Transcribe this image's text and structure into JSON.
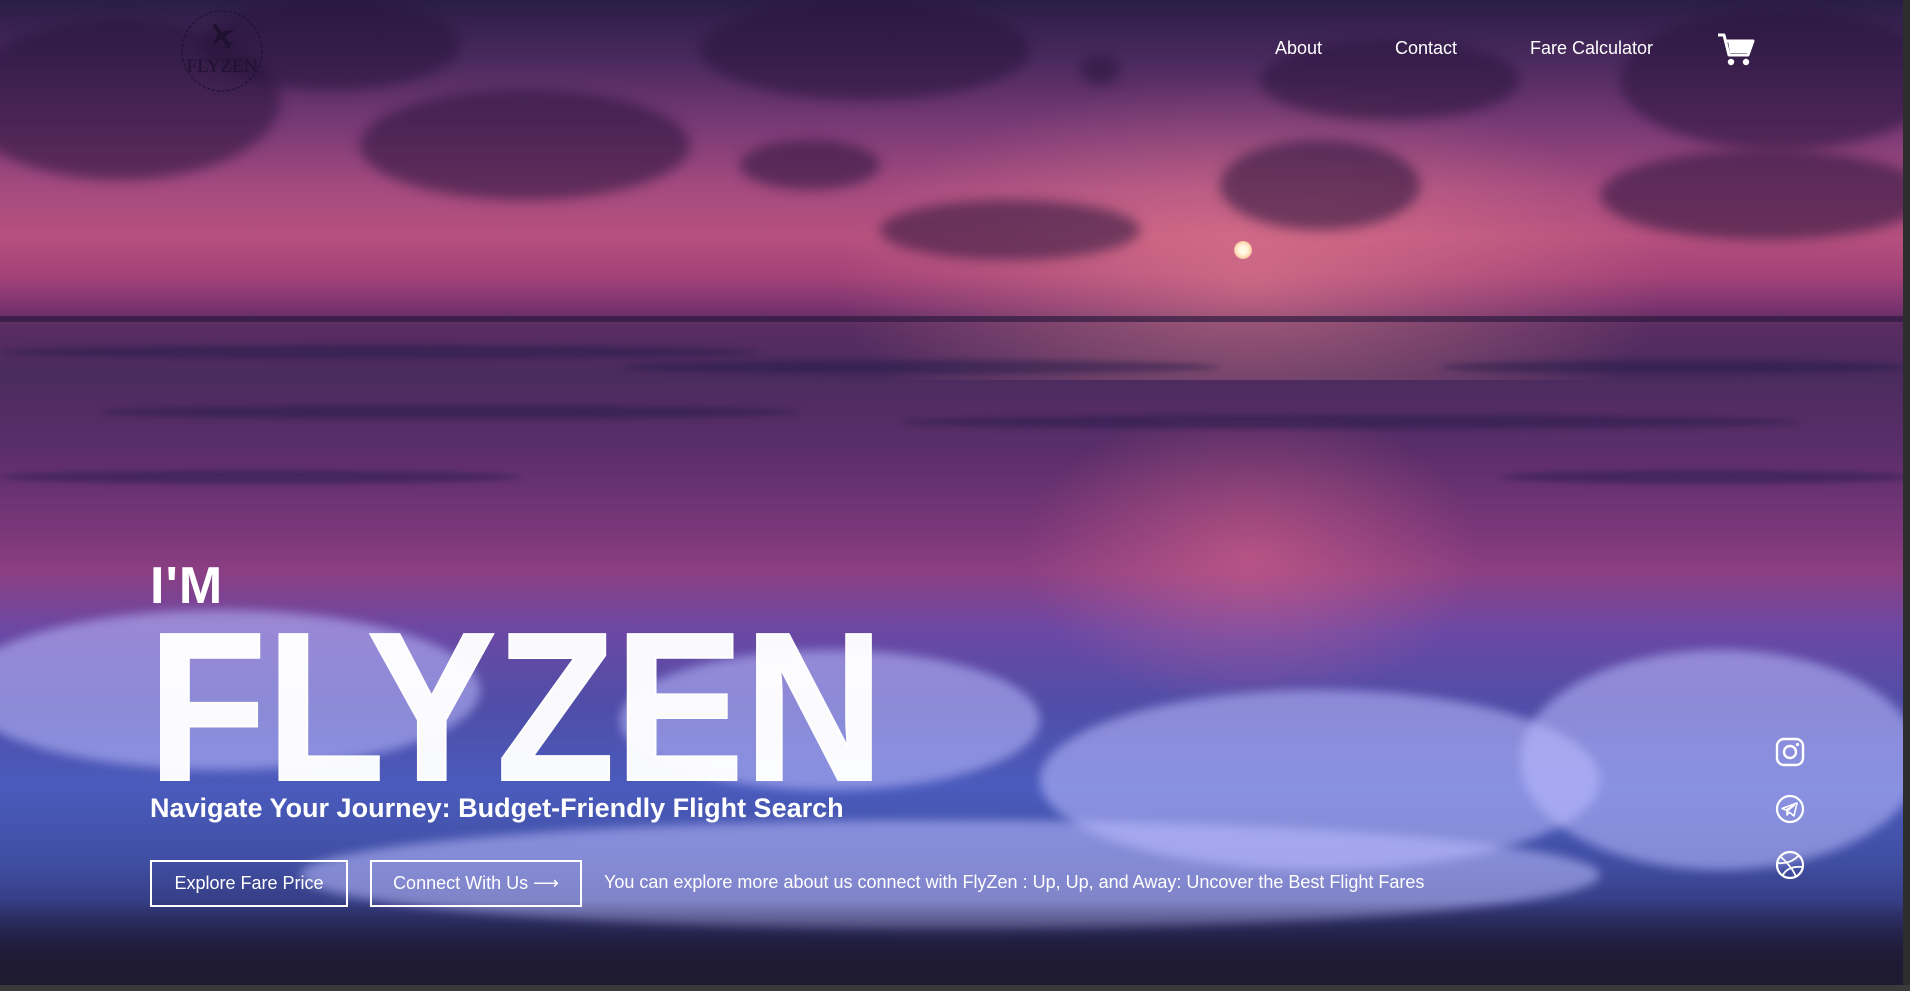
{
  "brand": {
    "logo_text": "FLYZEN"
  },
  "nav": {
    "items": [
      {
        "label": "About"
      },
      {
        "label": "Contact"
      },
      {
        "label": "Fare Calculator"
      }
    ],
    "cart_icon": "cart-icon"
  },
  "hero": {
    "pre_title": "I'M",
    "title": "FLYZEN",
    "tagline": "Navigate Your Journey: Budget-Friendly Flight Search",
    "buttons": {
      "explore": "Explore Fare Price",
      "connect": "Connect With Us ⟶"
    },
    "description": "You can explore more about us connect with FlyZen : Up, Up, and Away: Uncover the Best Flight Fares"
  },
  "social": [
    {
      "icon": "instagram-icon"
    },
    {
      "icon": "telegram-icon"
    },
    {
      "icon": "dribbble-icon"
    }
  ],
  "colors": {
    "text": "#ffffff",
    "sky_pink": "#b6507e",
    "sea_blue": "#4a5bbd"
  }
}
